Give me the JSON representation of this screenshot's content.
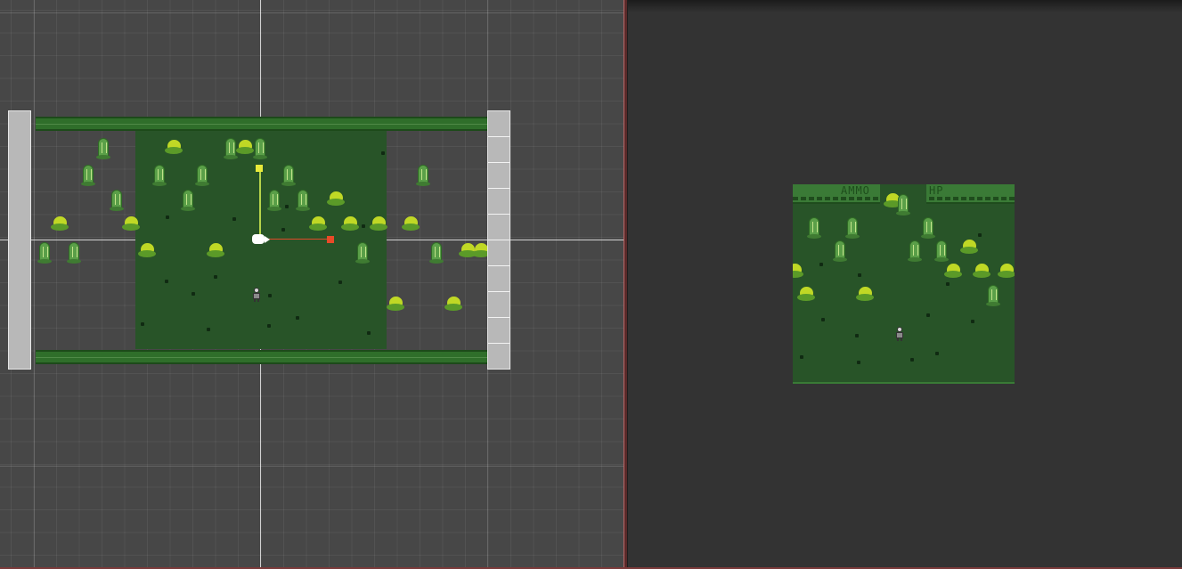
{
  "hud": {
    "ammo_label": "AMMO",
    "hp_label": "HP"
  },
  "colors": {
    "scene_background": "#474747",
    "grass": "#285428",
    "grass_border": "#2f6e2a",
    "bush": "#c0d825",
    "cactus": "#5a9f48",
    "gizmo_y": "#e8ea3a",
    "gizmo_x": "#ea4a28",
    "game_view_background": "#333333"
  },
  "icons": {
    "camera": "camera-icon",
    "move_handle_y": "y-axis-handle",
    "move_handle_x": "x-axis-handle"
  }
}
